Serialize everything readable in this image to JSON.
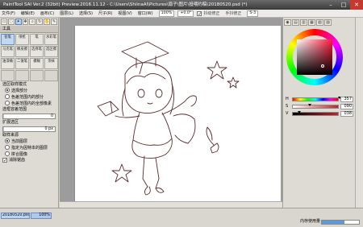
{
  "window": {
    "title": "PaintTool SAI Ver.2 (32bit) Preview.2016.11.12 - C:\\Users\\ShiinaAI\\Pictures\\扇子\\图片\\投喂约稿\\20180520.psd (*)"
  },
  "menubar": {
    "items": [
      "文件(F)",
      "编辑(E)",
      "画布(C)",
      "图层(L)",
      "选择(S)",
      "尺子(R)",
      "视图(V)",
      "窗口(W)"
    ],
    "zoom": "100%",
    "angle": "+0.0°",
    "antialias_label": "抖动修正",
    "antialias_checked": true,
    "stabilizer_label": "手抖修正",
    "stabilizer_value": "S-3"
  },
  "left_panel": {
    "tools_header": "工具",
    "brushes": [
      "铅笔",
      "喷枪",
      "笔",
      "水彩笔",
      "马克笔",
      "橡皮擦",
      "选择笔",
      "选区擦",
      "油漆桶",
      "二值笔",
      "模糊",
      "涂抹",
      "",
      "",
      "",
      ""
    ],
    "selected_brush_index": 0,
    "source_label": "选区取样模式",
    "source_options": [
      "选择部分",
      "色差范围内的部分",
      "色差范围内的全部像素"
    ],
    "source_selected": 0,
    "tolerance_label": "选框容差范围",
    "tolerance_value": "0",
    "expand_label": "扩展选区",
    "expand_value": "0 px",
    "sample_label": "取样来源",
    "sample_options": [
      "当前图层",
      "指定为因特本的图层",
      "拼合图像"
    ],
    "sample_selected": 0,
    "antialias_label": "消除锯齿",
    "antialias_checked": true
  },
  "color_panel": {
    "h_label": "H",
    "h_value": "357",
    "s_label": "S",
    "s_value": "090",
    "v_label": "V",
    "v_value": "038",
    "h_fraction": 0.99,
    "s_fraction": 0.35,
    "v_fraction": 0.15
  },
  "status": {
    "doc_tab": "20180520.psd",
    "doc_zoom": "100%",
    "memory_label": "内存使用量"
  },
  "colors": {
    "line": "#5a2a2a",
    "accent": "#c0232a",
    "selection": "#bcd3ef"
  }
}
